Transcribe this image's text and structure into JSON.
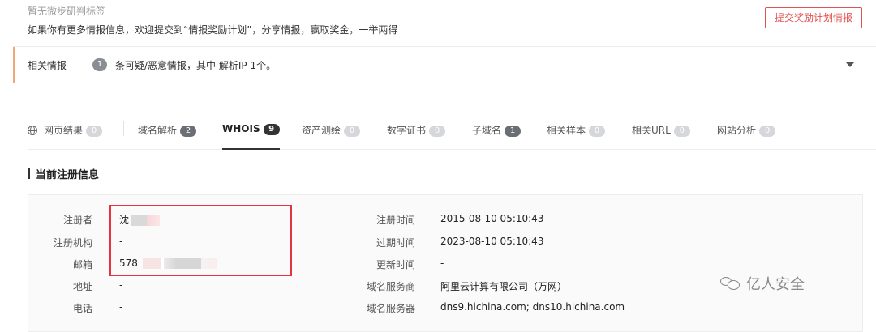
{
  "notice": {
    "tag_text": "暂无微步研判标签",
    "desc": "如果你有更多情报信息，欢迎提交到“情报奖励计划”，分享情报，赢取奖金，一举两得",
    "submit_label": "提交奖励计划情报"
  },
  "related_intel": {
    "label": "相关情报",
    "count": "1",
    "text": "条可疑/恶意情报，其中 解析IP 1个。"
  },
  "tabs": [
    {
      "label": "网页结果",
      "count": "0"
    },
    {
      "label": "域名解析",
      "count": "2"
    },
    {
      "label": "WHOIS",
      "count": "9"
    },
    {
      "label": "资产测绘",
      "count": "0"
    },
    {
      "label": "数字证书",
      "count": "0"
    },
    {
      "label": "子域名",
      "count": "1"
    },
    {
      "label": "相关样本",
      "count": "0"
    },
    {
      "label": "相关URL",
      "count": "0"
    },
    {
      "label": "网站分析",
      "count": "0"
    }
  ],
  "section": {
    "title": "当前注册信息"
  },
  "whois_left": [
    {
      "label": "注册者",
      "value": "沈"
    },
    {
      "label": "注册机构",
      "value": "-"
    },
    {
      "label": "邮箱",
      "value": "578"
    },
    {
      "label": "地址",
      "value": "-"
    },
    {
      "label": "电话",
      "value": "-"
    }
  ],
  "whois_right": [
    {
      "label": "注册时间",
      "value": "2015-08-10 05:10:43"
    },
    {
      "label": "过期时间",
      "value": "2023-08-10 05:10:43"
    },
    {
      "label": "更新时间",
      "value": "-"
    },
    {
      "label": "域名服务商",
      "value": "阿里云计算有限公司（万网）"
    },
    {
      "label": "域名服务器",
      "value": "dns9.hichina.com; dns10.hichina.com"
    }
  ],
  "watermark": {
    "text": "亿人安全"
  },
  "colors": {
    "accent_red": "#e0524f",
    "highlight_red": "#e3343f",
    "intel_accent": "#f1a877"
  }
}
